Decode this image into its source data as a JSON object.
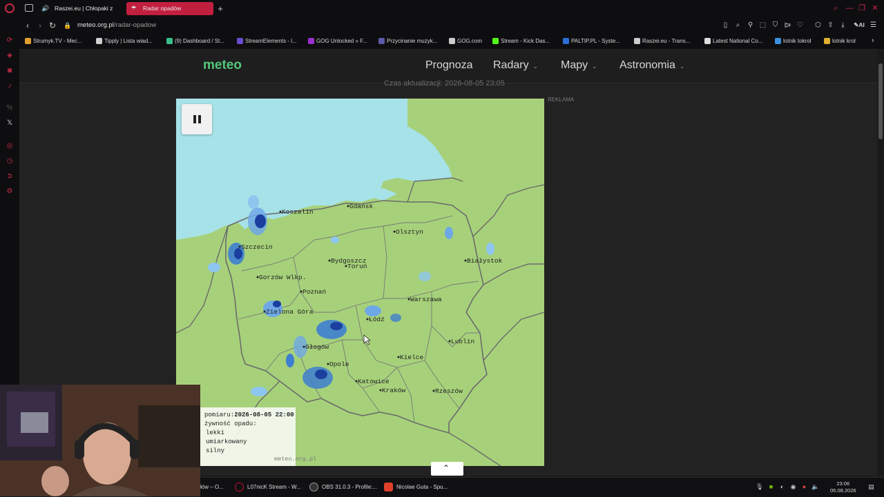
{
  "browser": {
    "tabs": [
      {
        "label": "Raszei.eu | Chłopaki z ",
        "icon": "speaker-icon"
      },
      {
        "label": "Radar opadów",
        "icon": "meteo-icon"
      }
    ],
    "new_tab": "+",
    "url_host": "meteo.org.pl",
    "url_path": "/radar-opadow",
    "ai_label": "AI"
  },
  "bookmarks": [
    {
      "label": "Strumyk.TV - Mec...",
      "color": "#e0a030"
    },
    {
      "label": "Tipply | Lista wiad...",
      "color": "#d0d0d0"
    },
    {
      "label": "(9) Dashboard / St...",
      "color": "#3bbf8a"
    },
    {
      "label": "StreamElements - l...",
      "color": "#6a4ccf"
    },
    {
      "label": "GOG Unlocked » F...",
      "color": "#9b2fd0"
    },
    {
      "label": "Przycinanie muzyk...",
      "color": "#5a5aa8"
    },
    {
      "label": "GOG.com",
      "color": "#cccccc"
    },
    {
      "label": "Stream - Kick Das...",
      "color": "#53fc18"
    },
    {
      "label": "PALTIP.PL - Syste...",
      "color": "#2a6fd6"
    },
    {
      "label": "Raszei.eu - Trans...",
      "color": "#cccccc"
    },
    {
      "label": "Latest National Co...",
      "color": "#dddddd"
    },
    {
      "label": "lotnik tokrol",
      "color": "#3b8fe0"
    },
    {
      "label": "lotnik krol",
      "color": "#e0b030"
    }
  ],
  "site": {
    "logo": "meteo",
    "nav": [
      "Prognoza",
      "Radary",
      "Mapy",
      "Astronomia"
    ],
    "update_text": "Czas aktualizacji: 2026-08-05 23:05",
    "ad_label": "REKLAMA"
  },
  "map": {
    "cities": [
      "Gdańsk",
      "Koszalin",
      "Olsztyn",
      "Szczecin",
      "Bydgoszcz",
      "Toruń",
      "Białystok",
      "Gorzów Wlkp.",
      "Poznań",
      "Warszawa",
      "Zielona Góra",
      "Łódź",
      "Lublin",
      "Głogów",
      "Kielce",
      "Opole",
      "Katowice",
      "Kraków",
      "Rzeszów"
    ],
    "legend": {
      "time_label": "pomiaru:",
      "time_value": "2026-08-05 22:00",
      "intensity_label": "żywność opadu:",
      "levels": [
        "lekki",
        "umiarkowany",
        "silny"
      ],
      "level_colors": [
        "#8fc6f0",
        "#3f7fd0",
        "#1a3f9e"
      ],
      "source": "meteo.org.pl"
    }
  },
  "taskbar": {
    "items": [
      {
        "label": "łów – O...",
        "color": "#c8102e"
      },
      {
        "label": "L07nicK Stream - W...",
        "color": "#c8102e"
      },
      {
        "label": "OBS 31.0.3 - Profile:...",
        "color": "#333333"
      },
      {
        "label": "Nicolae Guta - Spu...",
        "color": "#e0402a"
      }
    ],
    "clock_time": "23:06",
    "clock_date": "05.08.2026"
  }
}
